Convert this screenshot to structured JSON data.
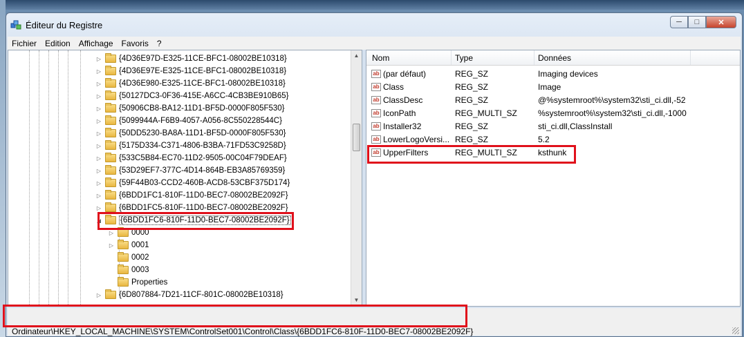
{
  "window": {
    "title": "Éditeur du Registre"
  },
  "menu": [
    "Fichier",
    "Edition",
    "Affichage",
    "Favoris",
    "?"
  ],
  "tree": {
    "keys": [
      {
        "label": "{4D36E97D-E325-11CE-BFC1-08002BE10318}"
      },
      {
        "label": "{4D36E97E-E325-11CE-BFC1-08002BE10318}"
      },
      {
        "label": "{4D36E980-E325-11CE-BFC1-08002BE10318}"
      },
      {
        "label": "{50127DC3-0F36-415E-A6CC-4CB3BE910B65}"
      },
      {
        "label": "{50906CB8-BA12-11D1-BF5D-0000F805F530}"
      },
      {
        "label": "{5099944A-F6B9-4057-A056-8C550228544C}"
      },
      {
        "label": "{50DD5230-BA8A-11D1-BF5D-0000F805F530}"
      },
      {
        "label": "{5175D334-C371-4806-B3BA-71FD53C9258D}"
      },
      {
        "label": "{533C5B84-EC70-11D2-9505-00C04F79DEAF}"
      },
      {
        "label": "{53D29EF7-377C-4D14-864B-EB3A85769359}"
      },
      {
        "label": "{59F44B03-CCD2-460B-ACD8-53CBF375D174}"
      },
      {
        "label": "{6BDD1FC1-810F-11D0-BEC7-08002BE2092F}"
      },
      {
        "label": "{6BDD1FC5-810F-11D0-BEC7-08002BE2092F}"
      },
      {
        "label": "{6BDD1FC6-810F-11D0-BEC7-08002BE2092F}"
      }
    ],
    "subkeys": [
      "0000",
      "0001",
      "0002",
      "0003",
      "Properties"
    ],
    "after": [
      "{6D807884-7D21-11CF-801C-08002BE10318}"
    ]
  },
  "list": {
    "headers": [
      "Nom",
      "Type",
      "Données"
    ],
    "rows": [
      {
        "name": "(par défaut)",
        "type": "REG_SZ",
        "data": "Imaging devices"
      },
      {
        "name": "Class",
        "type": "REG_SZ",
        "data": "Image"
      },
      {
        "name": "ClassDesc",
        "type": "REG_SZ",
        "data": "@%systemroot%\\system32\\sti_ci.dll,-52"
      },
      {
        "name": "IconPath",
        "type": "REG_MULTI_SZ",
        "data": "%systemroot%\\system32\\sti_ci.dll,-1000"
      },
      {
        "name": "Installer32",
        "type": "REG_SZ",
        "data": "sti_ci.dll,ClassInstall"
      },
      {
        "name": "LowerLogoVersi...",
        "type": "REG_SZ",
        "data": "5.2"
      },
      {
        "name": "UpperFilters",
        "type": "REG_MULTI_SZ",
        "data": "ksthunk"
      }
    ]
  },
  "status": {
    "path": "Ordinateur\\HKEY_LOCAL_MACHINE\\SYSTEM\\ControlSet001\\Control\\Class\\{6BDD1FC6-810F-11D0-BEC7-08002BE2092F}"
  },
  "colors": {
    "highlight_box": "#e0101b",
    "folder": "#e9b640",
    "window_frame": "#dbe6f3"
  },
  "icons": {
    "app": "registry-editor-icon",
    "folder": "folder-icon",
    "string_value": "string-value-icon"
  }
}
